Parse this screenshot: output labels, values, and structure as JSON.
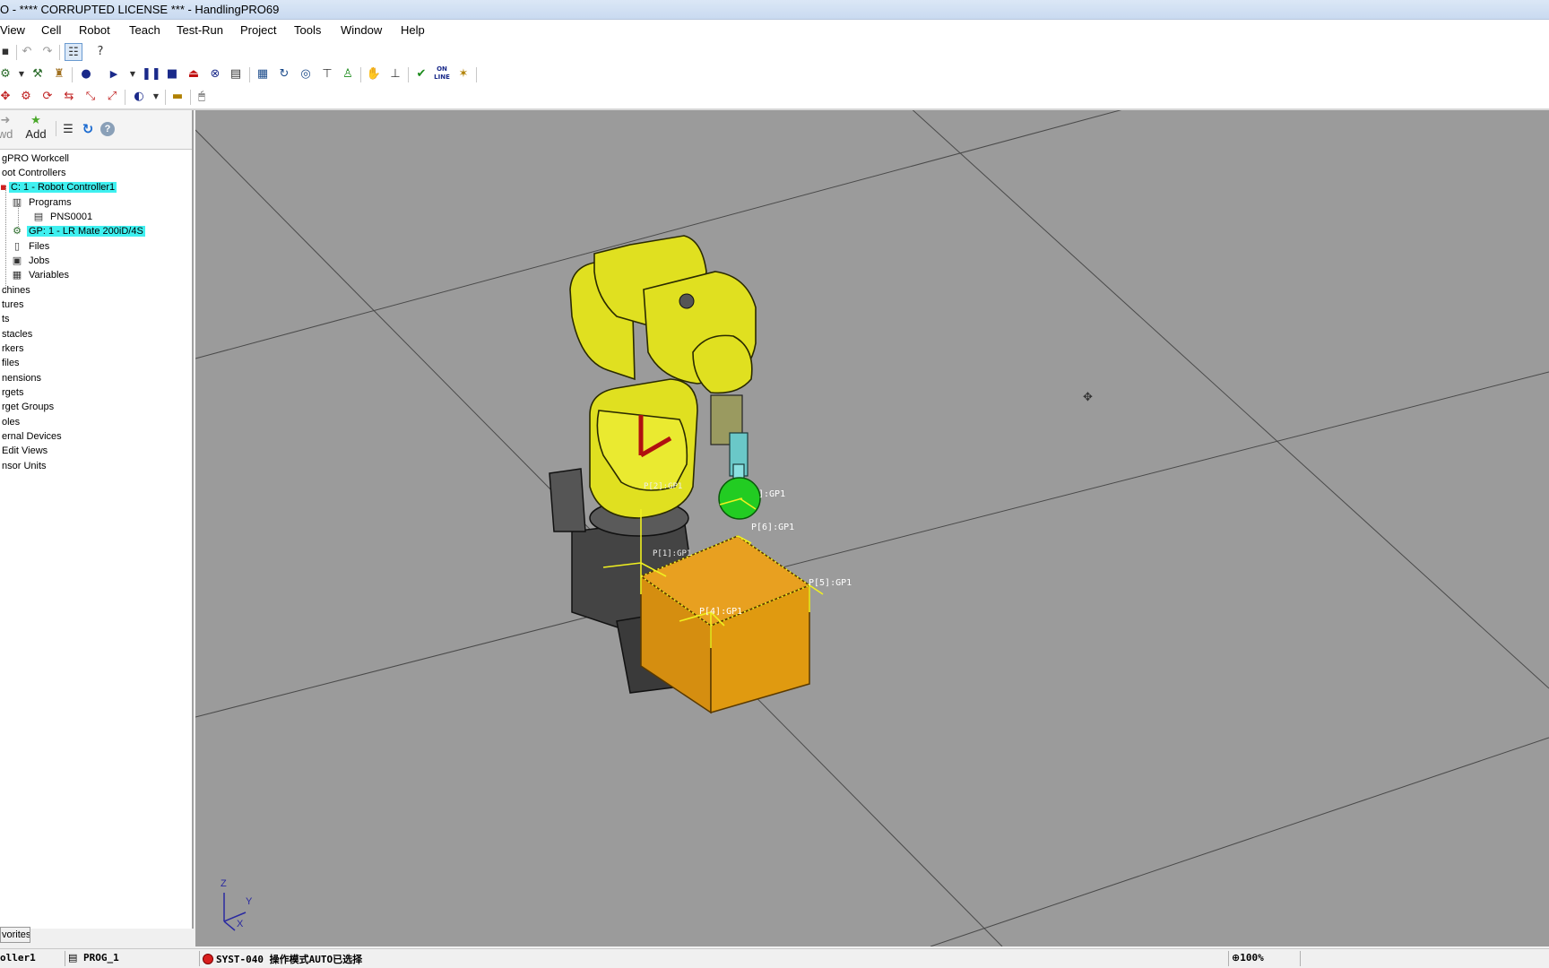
{
  "window": {
    "title": "O - **** CORRUPTED LICENSE *** - HandlingPRO69"
  },
  "menu": [
    "View",
    "Cell",
    "Robot",
    "Teach",
    "Test-Run",
    "Project",
    "Tools",
    "Window",
    "Help"
  ],
  "left_panel": {
    "toolbar": {
      "fwd_label": "wd",
      "add_label": "Add"
    },
    "tree": [
      {
        "label": "gPRO Workcell"
      },
      {
        "label": "oot Controllers"
      },
      {
        "label": "C: 1 - Robot Controller1",
        "selected": true
      },
      {
        "label": "Programs"
      },
      {
        "label": "PNS0001"
      },
      {
        "label": "GP: 1 - LR Mate 200iD/4S",
        "selected": true
      },
      {
        "label": "Files"
      },
      {
        "label": "Jobs"
      },
      {
        "label": "Variables"
      },
      {
        "label": "chines"
      },
      {
        "label": "tures"
      },
      {
        "label": "ts"
      },
      {
        "label": "stacles"
      },
      {
        "label": "rkers"
      },
      {
        "label": "files"
      },
      {
        "label": "nensions"
      },
      {
        "label": "rgets"
      },
      {
        "label": "rget Groups"
      },
      {
        "label": "oles"
      },
      {
        "label": "ernal Devices"
      },
      {
        "label": "Edit Views"
      },
      {
        "label": "nsor Units"
      }
    ],
    "favorites_tab": "vorites"
  },
  "viewport": {
    "position_labels": [
      "]:GP1",
      "P[6]:GP1",
      "P[5]:GP1",
      "P[4]:GP1",
      "P[2]:GP1",
      "P[1]:GP1"
    ],
    "axis_labels": {
      "x": "X",
      "y": "Y",
      "z": "Z"
    },
    "colors": {
      "floor": "#9b9b9b",
      "robot": "#e0e020",
      "part": "#e09a10",
      "gripper_ball": "#22cc22"
    }
  },
  "status": {
    "controller": "oller1",
    "program": "PROG_1",
    "alarm": "SYST-040 操作模式AUTO已选择",
    "zoom": "100%"
  }
}
